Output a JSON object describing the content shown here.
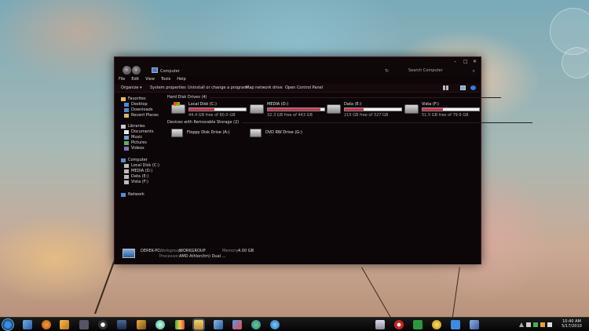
{
  "window": {
    "address": "Computer",
    "search_placeholder": "Search Computer",
    "controls": [
      "–",
      "□",
      "✕"
    ]
  },
  "menu": [
    "File",
    "Edit",
    "View",
    "Tools",
    "Help"
  ],
  "commands": {
    "organize": "Organize ▾",
    "system_properties": "System properties",
    "uninstall": "Uninstall or change a program",
    "map_drive": "Map network drive",
    "control_panel": "Open Control Panel"
  },
  "navigation": {
    "favorites": "Favorites",
    "desktop": "Desktop",
    "downloads": "Downloads",
    "recent_places": "Recent Places",
    "libraries": "Libraries",
    "documents": "Documents",
    "music": "Music",
    "pictures": "Pictures",
    "videos": "Videos",
    "computer": "Computer",
    "local_disk": "Local Disk (C:)",
    "media": "MEDIA (D:)",
    "data": "Data (E:)",
    "vista": "Vista (F:)",
    "network": "Network"
  },
  "groups": {
    "hard_disks": "Hard Disk Drives (4)",
    "removable": "Devices with Removable Storage (2)"
  },
  "drives": [
    {
      "name": "Local Disk (C:)",
      "free": "44.4 GB free of 80.0 GB",
      "used_fraction": 0.45
    },
    {
      "name": "MEDIA (D:)",
      "free": "32.3 GB free of 443 GB",
      "used_fraction": 0.93
    },
    {
      "name": "Data (E:)",
      "free": "215 GB free of 327 GB",
      "used_fraction": 0.34
    },
    {
      "name": "Vista (F:)",
      "free": "51.5 GB free of 79.9 GB",
      "used_fraction": 0.36
    }
  ],
  "removable": [
    {
      "name": "Floppy Disk Drive (A:)"
    },
    {
      "name": "DVD RW Drive (G:)"
    }
  ],
  "details": {
    "pc_name": "DEREK-PC",
    "workgroup_label": "Workgroup:",
    "workgroup": "WORKGROUP",
    "memory_label": "Memory:",
    "memory": "4.00 GB",
    "processor_label": "Processor:",
    "processor": "AMD Athlon(tm) Dual ..."
  },
  "clock": {
    "time": "10:40 AM",
    "date": "5/17/2010"
  },
  "colors": {
    "accent": "#c0203e",
    "window_bg": "#0d0608"
  }
}
